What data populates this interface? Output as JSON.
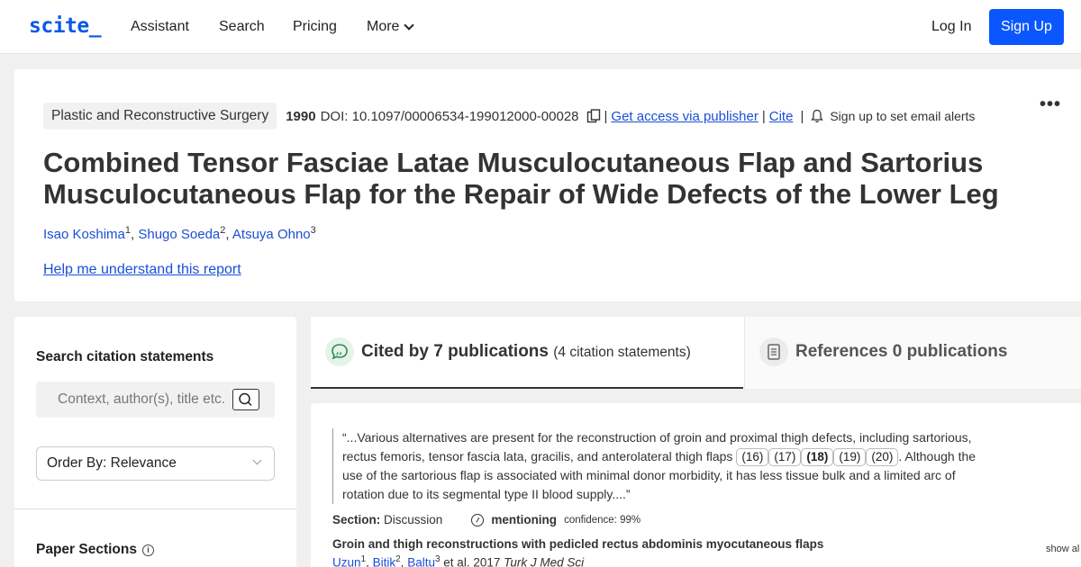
{
  "nav": {
    "logo": "scite_",
    "assistant": "Assistant",
    "search": "Search",
    "pricing": "Pricing",
    "more": "More",
    "login": "Log In",
    "signup": "Sign Up"
  },
  "paper": {
    "journal": "Plastic and Reconstructive Surgery",
    "year": "1990",
    "doi": "DOI: 10.1097/00006534-199012000-00028",
    "get_access": "Get access via publisher",
    "cite": "Cite",
    "alerts": "Sign up to set email alerts",
    "title": "Combined Tensor Fasciae Latae Musculocutaneous Flap and Sartorius Musculocutaneous Flap for the Repair of Wide Defects of the Lower Leg",
    "authors": [
      {
        "name": "Isao Koshima",
        "sup": "1"
      },
      {
        "name": "Shugo Soeda",
        "sup": "2"
      },
      {
        "name": "Atsuya Ohno",
        "sup": "3"
      }
    ],
    "help_link": "Help me understand this report"
  },
  "sidebar": {
    "search_heading": "Search citation statements",
    "search_placeholder": "Context, author(s), title etc.",
    "order_by": "Order By: Relevance",
    "sections_heading": "Paper Sections"
  },
  "tabs": {
    "cited_label": "Cited by 7 publications",
    "cited_sub": "(4 citation statements)",
    "refs_label": "References 0 publications"
  },
  "citation": {
    "quote_part1": "“...Various alternatives are present for the reconstruction of groin and proximal thigh defects, including sartorious, rectus femoris, tensor fascia lata, gracilis, and anterolateral thigh flaps",
    "refs": [
      "(16)",
      "(17)",
      "(18)",
      "(19)",
      "(20)"
    ],
    "quote_part2": ". Although the use of the sartorious flap is associated with minimal donor morbidity, it has less tissue bulk and a limited arc of rotation due to its segmental type II blood supply....”",
    "section_label": "Section:",
    "section_value": "Discussion",
    "classification": "mentioning",
    "confidence": "confidence: 99%",
    "paper_title": "Groin and thigh reconstructions with pedicled rectus abdominis myocutaneous flaps",
    "paper_authors": [
      {
        "name": "Uzun",
        "sup": "1"
      },
      {
        "name": "Bitik",
        "sup": "2"
      },
      {
        "name": "Baltu",
        "sup": "3"
      }
    ],
    "etal_year": "et al. 2017",
    "journal": "Turk J Med Sci",
    "show_all": "show al"
  },
  "colors": {
    "brand": "#0a58e8",
    "signup_bg": "#0b57ff",
    "link": "#1a4fd6",
    "cite_icon_bg": "#e5f3ea",
    "cite_icon_fg": "#2e8b57"
  }
}
